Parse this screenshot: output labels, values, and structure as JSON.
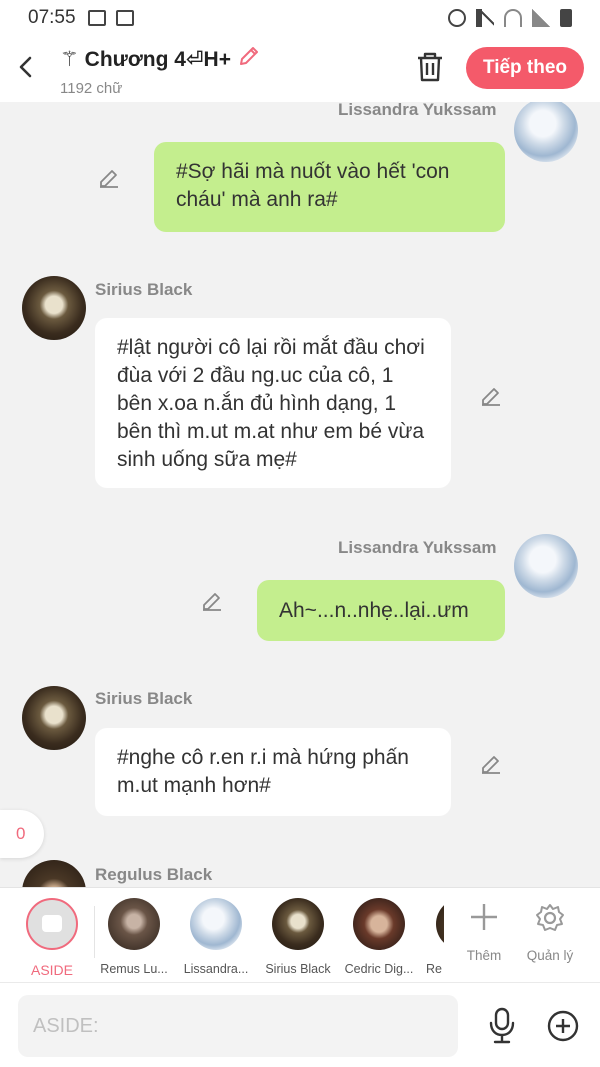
{
  "status_bar": {
    "time": "07:55"
  },
  "header": {
    "title": "⚚ Chương 4⏎H+",
    "word_count": "1192 chữ",
    "next_label": "Tiếp theo"
  },
  "messages": [
    {
      "sender": "Lissandra Yukssam",
      "text": "#Sợ hãi mà nuốt vào hết 'con cháu' mà anh ra#"
    },
    {
      "sender": "Sirius Black",
      "text": "#lật người cô lại rồi mắt đầu chơi đùa với 2 đầu ng.uc của cô, 1 bên x.oa n.ắn đủ hình dạng, 1 bên thì m.ut m.at như em bé vừa sinh uống sữa mẹ#"
    },
    {
      "sender": "Lissandra Yukssam",
      "text": "Ah~...n..nhẹ..lại..ưm"
    },
    {
      "sender": "Sirius Black",
      "text": "#nghe cô r.en r.i mà hứng phấn m.ut mạnh hơn#"
    },
    {
      "sender": "Regulus Black"
    }
  ],
  "unread_count": "0",
  "characters": [
    {
      "label": "ASIDE"
    },
    {
      "label": "Remus Lu..."
    },
    {
      "label": "Lissandra..."
    },
    {
      "label": "Sirius Black"
    },
    {
      "label": "Cedric Dig..."
    },
    {
      "label": "Re"
    }
  ],
  "tools": {
    "add_label": "Thêm",
    "manage_label": "Quản lý"
  },
  "composer": {
    "placeholder": "ASIDE:"
  },
  "colors": {
    "accent": "#f45a6a",
    "own_bubble": "#c4ee8e",
    "other_bubble": "#ffffff"
  },
  "icons": [
    "back-icon",
    "edit-pencil-icon",
    "trash-icon",
    "aside-chat-icon",
    "plus-icon",
    "gear-icon",
    "microphone-icon",
    "add-circle-icon"
  ]
}
